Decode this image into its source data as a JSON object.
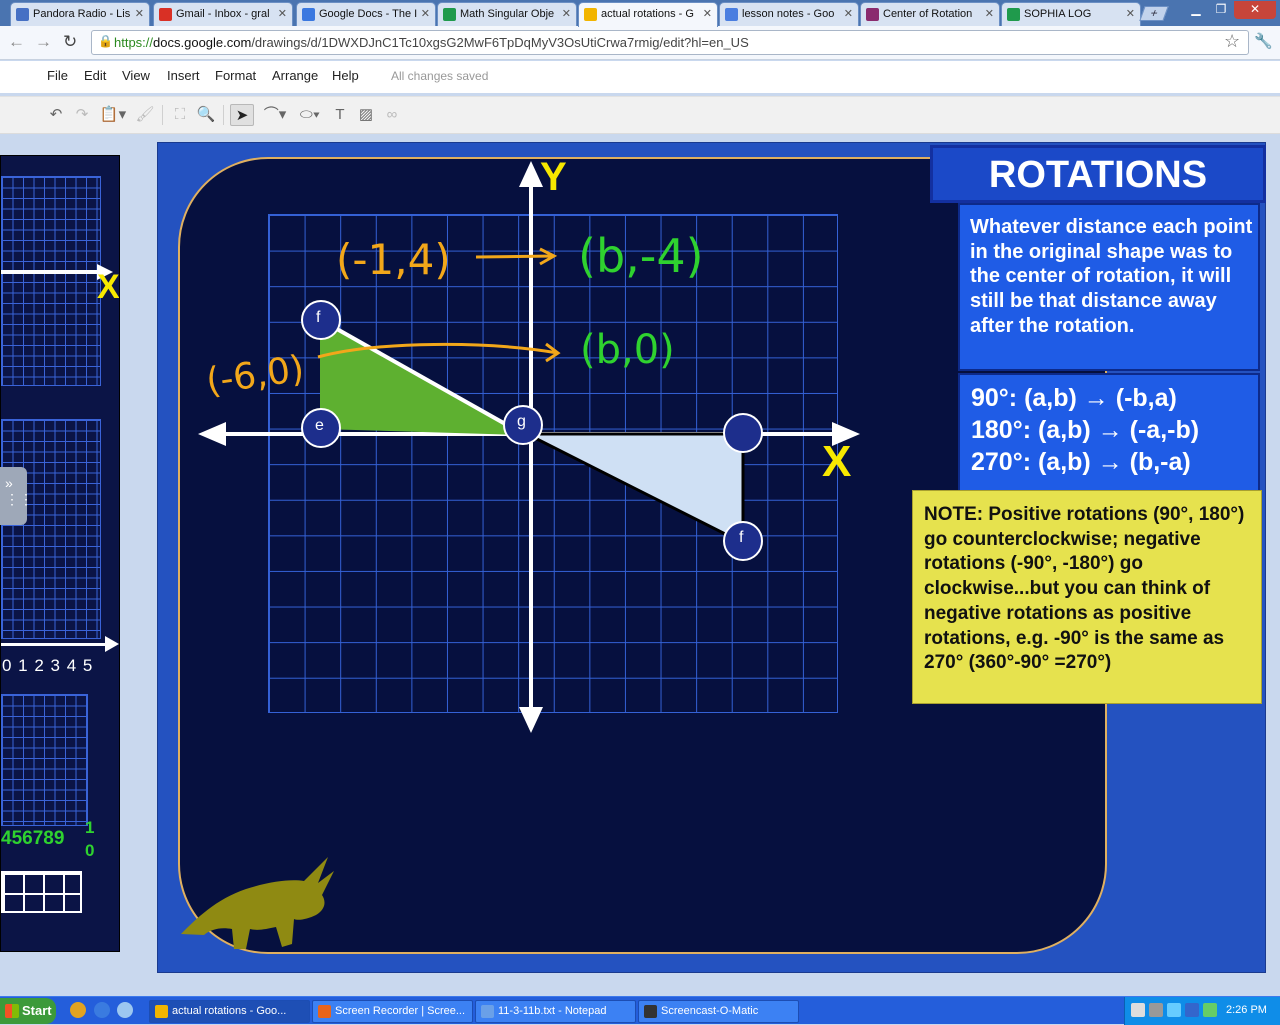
{
  "browser": {
    "tabs": [
      {
        "label": "Pandora Radio - Lis",
        "color": "#4670c4"
      },
      {
        "label": "Gmail - Inbox - gral",
        "color": "#d93025"
      },
      {
        "label": "Google Docs - The I",
        "color": "#3a78e0"
      },
      {
        "label": "Math Singular Obje",
        "color": "#1f9a4c"
      },
      {
        "label": "actual rotations - G",
        "color": "#f2b500"
      },
      {
        "label": "lesson notes - Goo",
        "color": "#4a7ee0"
      },
      {
        "label": "Center of Rotation",
        "color": "#8a2b6e"
      },
      {
        "label": "SOPHIA LOG",
        "color": "#1f9a4c"
      }
    ],
    "url_scheme": "https://",
    "url_host": "docs.google.com",
    "url_rest": "/drawings/d/1DWXDJnC1Tc10xgsG2MwF6TpDqMyV3OsUtiCrwa7rmig/edit?hl=en_US"
  },
  "menus": [
    "File",
    "Edit",
    "View",
    "Insert",
    "Format",
    "Arrange",
    "Help"
  ],
  "save_status": "All changes saved",
  "slide": {
    "title": "ROTATIONS",
    "axis_y": "Y",
    "axis_x": "X",
    "info": "Whatever distance each point in the original shape was to the center of rotation, it will still be that distance away after the rotation.",
    "rules": [
      "90°: (a,b) → (-b,a)",
      "180°: (a,b) → (-a,-b)",
      "270°: (a,b) → (b,-a)"
    ],
    "note": "NOTE: Positive rotations (90°, 180°) go counterclockwise; negative rotations (-90°, -180°) go clockwise...but you can think of negative rotations as positive rotations, e.g. -90° is the same as 270° (360°-90° =270°)",
    "points": {
      "f": "f",
      "e": "e",
      "g": "g",
      "f2": "f"
    },
    "handwriting": {
      "left1": "(-1,4)",
      "right1": "(b,-4)",
      "left2": "(-6,0)",
      "right2": "(b,0)"
    },
    "colors": {
      "shape": "#5eb030",
      "image": "#cfe0f4",
      "orange": "#f2a71a",
      "green": "#2fd22f"
    }
  },
  "left_slide": {
    "axis_x": "X",
    "ticks": "0 1 2 3 4 5",
    "ticks2": "456789",
    "ticks2b": "1",
    "ticks2c": "0"
  },
  "taskbar": {
    "start": "Start",
    "tasks": [
      {
        "label": "actual rotations - Goo...",
        "color": "#f2b500"
      },
      {
        "label": "Screen Recorder | Scree...",
        "color": "#e8641b"
      },
      {
        "label": "11-3-11b.txt - Notepad",
        "color": "#6aa0e8"
      },
      {
        "label": "Screencast-O-Matic",
        "color": "#333333"
      }
    ],
    "clock": "2:26 PM"
  }
}
